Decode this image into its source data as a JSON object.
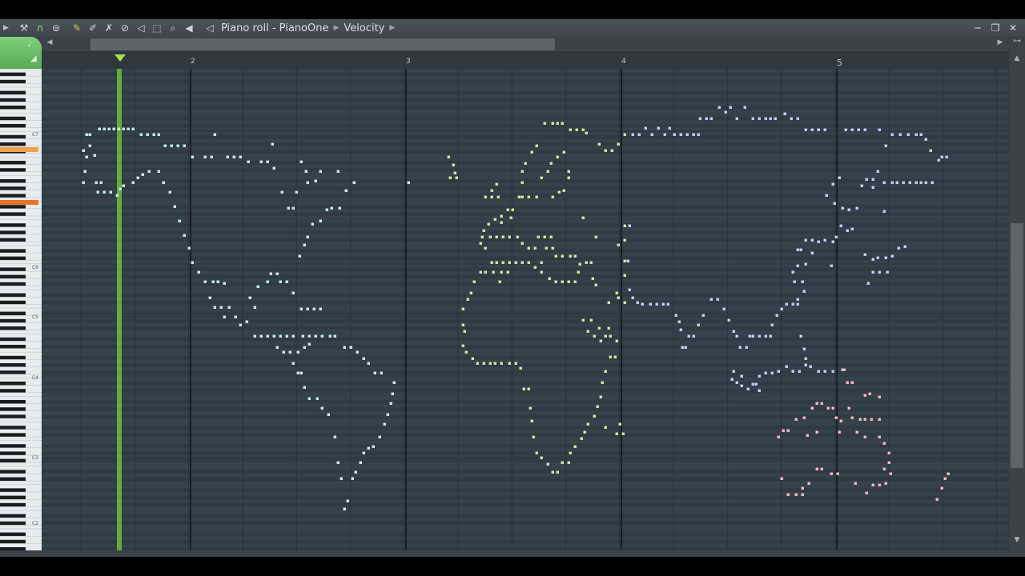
{
  "window": {
    "title": "Piano roll - PianoOne",
    "target": "Velocity",
    "controls": {
      "minimize": "─",
      "restore": "❐",
      "close": "✕"
    }
  },
  "toolbar": {
    "icons": [
      "arrow-icon",
      "wrench-icon",
      "magnet-icon",
      "menu-icon",
      "pencil-icon",
      "paint-icon",
      "delete-icon",
      "mute-icon",
      "slice-icon",
      "select-icon",
      "zoom-icon",
      "playback-icon",
      "speaker-icon"
    ]
  },
  "ruler": {
    "bars": [
      "2",
      "3",
      "4",
      "5"
    ]
  },
  "keyboard": {
    "octave_labels": [
      "C7",
      "C6",
      "C5",
      "C4",
      "C3",
      "C2"
    ]
  },
  "colors": {
    "grid_bg": "#34404a",
    "bar_line": "#1a2024",
    "playhead": "#7ccc3c",
    "note_blue": "#c7e6ea",
    "note_green": "#c8e6a0",
    "note_purple": "#c8c8f0",
    "note_pink": "#f2b6be"
  },
  "notes": [
    [
      108,
      168
    ],
    [
      112,
      168
    ],
    [
      124,
      161
    ],
    [
      130,
      161
    ],
    [
      136,
      161
    ],
    [
      142,
      161
    ],
    [
      148,
      161
    ],
    [
      154,
      161
    ],
    [
      160,
      161
    ],
    [
      166,
      161
    ],
    [
      176,
      168
    ],
    [
      184,
      168
    ],
    [
      192,
      168
    ],
    [
      198,
      168
    ],
    [
      104,
      188
    ],
    [
      108,
      196
    ],
    [
      106,
      214
    ],
    [
      112,
      182
    ],
    [
      118,
      194
    ],
    [
      206,
      182
    ],
    [
      214,
      182
    ],
    [
      222,
      182
    ],
    [
      230,
      182
    ],
    [
      240,
      196
    ],
    [
      256,
      196
    ],
    [
      264,
      196
    ],
    [
      284,
      196
    ],
    [
      292,
      196
    ],
    [
      300,
      196
    ],
    [
      310,
      202
    ],
    [
      104,
      228
    ],
    [
      120,
      228
    ],
    [
      126,
      228
    ],
    [
      122,
      240
    ],
    [
      130,
      240
    ],
    [
      138,
      240
    ],
    [
      146,
      244
    ],
    [
      150,
      236
    ],
    [
      154,
      232
    ],
    [
      166,
      228
    ],
    [
      172,
      222
    ],
    [
      178,
      218
    ],
    [
      186,
      214
    ],
    [
      198,
      214
    ],
    [
      204,
      228
    ],
    [
      212,
      240
    ],
    [
      218,
      258
    ],
    [
      224,
      276
    ],
    [
      230,
      294
    ],
    [
      236,
      310
    ],
    [
      240,
      328
    ],
    [
      248,
      340
    ],
    [
      256,
      352
    ],
    [
      266,
      352
    ],
    [
      272,
      352
    ],
    [
      280,
      354
    ],
    [
      262,
      372
    ],
    [
      268,
      384
    ],
    [
      276,
      384
    ],
    [
      280,
      396
    ],
    [
      286,
      384
    ],
    [
      294,
      396
    ],
    [
      300,
      406
    ],
    [
      308,
      402
    ],
    [
      312,
      372
    ],
    [
      318,
      384
    ],
    [
      322,
      358
    ],
    [
      334,
      352
    ],
    [
      338,
      342
    ],
    [
      346,
      342
    ],
    [
      350,
      352
    ],
    [
      358,
      352
    ],
    [
      366,
      366
    ],
    [
      376,
      386
    ],
    [
      384,
      386
    ],
    [
      392,
      386
    ],
    [
      400,
      386
    ],
    [
      326,
      202
    ],
    [
      334,
      202
    ],
    [
      340,
      180
    ],
    [
      342,
      210
    ],
    [
      352,
      240
    ],
    [
      360,
      260
    ],
    [
      366,
      260
    ],
    [
      370,
      240
    ],
    [
      376,
      202
    ],
    [
      382,
      214
    ],
    [
      384,
      228
    ],
    [
      394,
      226
    ],
    [
      400,
      214
    ],
    [
      408,
      262
    ],
    [
      414,
      260
    ],
    [
      422,
      214
    ],
    [
      424,
      260
    ],
    [
      432,
      238
    ],
    [
      442,
      228
    ],
    [
      400,
      276
    ],
    [
      390,
      280
    ],
    [
      384,
      296
    ],
    [
      380,
      306
    ],
    [
      374,
      320
    ],
    [
      268,
      168
    ],
    [
      510,
      228
    ],
    [
      318,
      420
    ],
    [
      326,
      420
    ],
    [
      334,
      420
    ],
    [
      342,
      420
    ],
    [
      350,
      420
    ],
    [
      358,
      420
    ],
    [
      366,
      420
    ],
    [
      378,
      420
    ],
    [
      386,
      420
    ],
    [
      394,
      420
    ],
    [
      402,
      420
    ],
    [
      412,
      420
    ],
    [
      418,
      420
    ],
    [
      346,
      434
    ],
    [
      354,
      440
    ],
    [
      362,
      440
    ],
    [
      372,
      440
    ],
    [
      380,
      434
    ],
    [
      386,
      430
    ],
    [
      366,
      454
    ],
    [
      372,
      466
    ],
    [
      430,
      434
    ],
    [
      438,
      434
    ],
    [
      446,
      440
    ],
    [
      454,
      448
    ],
    [
      460,
      454
    ],
    [
      468,
      466
    ],
    [
      476,
      466
    ],
    [
      492,
      478
    ],
    [
      490,
      492
    ],
    [
      488,
      504
    ],
    [
      484,
      518
    ],
    [
      480,
      530
    ],
    [
      474,
      546
    ],
    [
      466,
      558
    ],
    [
      460,
      560
    ],
    [
      454,
      566
    ],
    [
      450,
      578
    ],
    [
      444,
      590
    ],
    [
      440,
      598
    ],
    [
      434,
      626
    ],
    [
      430,
      636
    ],
    [
      426,
      598
    ],
    [
      422,
      578
    ],
    [
      418,
      546
    ],
    [
      410,
      518
    ],
    [
      402,
      510
    ],
    [
      396,
      498
    ],
    [
      386,
      498
    ],
    [
      380,
      484
    ],
    [
      376,
      466
    ],
    [
      560,
      196
    ],
    [
      566,
      206
    ],
    [
      568,
      216
    ],
    [
      562,
      222
    ],
    [
      570,
      222
    ],
    [
      680,
      154
    ],
    [
      690,
      154
    ],
    [
      696,
      154
    ],
    [
      702,
      154
    ],
    [
      712,
      162
    ],
    [
      720,
      162
    ],
    [
      728,
      162
    ],
    [
      732,
      166
    ],
    [
      670,
      182
    ],
    [
      664,
      190
    ],
    [
      656,
      204
    ],
    [
      652,
      214
    ],
    [
      652,
      228
    ],
    [
      648,
      246
    ],
    [
      634,
      262
    ],
    [
      626,
      270
    ],
    [
      618,
      274
    ],
    [
      610,
      280
    ],
    [
      604,
      288
    ],
    [
      602,
      296
    ],
    [
      612,
      296
    ],
    [
      620,
      296
    ],
    [
      628,
      296
    ],
    [
      636,
      296
    ],
    [
      646,
      296
    ],
    [
      652,
      304
    ],
    [
      660,
      310
    ],
    [
      668,
      310
    ],
    [
      672,
      296
    ],
    [
      680,
      296
    ],
    [
      688,
      296
    ],
    [
      676,
      222
    ],
    [
      684,
      214
    ],
    [
      688,
      204
    ],
    [
      696,
      196
    ],
    [
      704,
      190
    ],
    [
      710,
      214
    ],
    [
      710,
      222
    ],
    [
      704,
      238
    ],
    [
      698,
      240
    ],
    [
      690,
      246
    ],
    [
      670,
      246
    ],
    [
      660,
      246
    ],
    [
      652,
      246
    ],
    [
      620,
      230
    ],
    [
      614,
      238
    ],
    [
      606,
      246
    ],
    [
      614,
      246
    ],
    [
      622,
      246
    ],
    [
      614,
      328
    ],
    [
      620,
      328
    ],
    [
      628,
      328
    ],
    [
      636,
      328
    ],
    [
      644,
      328
    ],
    [
      652,
      328
    ],
    [
      660,
      328
    ],
    [
      668,
      334
    ],
    [
      676,
      340
    ],
    [
      686,
      348
    ],
    [
      694,
      352
    ],
    [
      702,
      352
    ],
    [
      710,
      352
    ],
    [
      718,
      352
    ],
    [
      722,
      340
    ],
    [
      724,
      330
    ],
    [
      732,
      328
    ],
    [
      738,
      328
    ],
    [
      740,
      348
    ],
    [
      744,
      356
    ],
    [
      694,
      320
    ],
    [
      702,
      320
    ],
    [
      712,
      320
    ],
    [
      718,
      320
    ],
    [
      682,
      310
    ],
    [
      690,
      310
    ],
    [
      676,
      328
    ],
    [
      624,
      352
    ],
    [
      606,
      340
    ],
    [
      600,
      340
    ],
    [
      616,
      340
    ],
    [
      638,
      272
    ],
    [
      626,
      278
    ],
    [
      640,
      262
    ],
    [
      728,
      272
    ],
    [
      744,
      296
    ],
    [
      626,
      340
    ],
    [
      634,
      340
    ],
    [
      606,
      310
    ],
    [
      600,
      304
    ],
    [
      592,
      352
    ],
    [
      588,
      366
    ],
    [
      584,
      374
    ],
    [
      578,
      386
    ],
    [
      578,
      406
    ],
    [
      580,
      414
    ],
    [
      578,
      432
    ],
    [
      582,
      440
    ],
    [
      590,
      448
    ],
    [
      596,
      454
    ],
    [
      604,
      454
    ],
    [
      612,
      454
    ],
    [
      618,
      454
    ],
    [
      626,
      454
    ],
    [
      636,
      454
    ],
    [
      644,
      454
    ],
    [
      650,
      460
    ],
    [
      654,
      486
    ],
    [
      660,
      486
    ],
    [
      662,
      510
    ],
    [
      664,
      526
    ],
    [
      666,
      546
    ],
    [
      670,
      566
    ],
    [
      676,
      572
    ],
    [
      684,
      580
    ],
    [
      690,
      590
    ],
    [
      696,
      590
    ],
    [
      702,
      578
    ],
    [
      710,
      578
    ],
    [
      712,
      566
    ],
    [
      718,
      558
    ],
    [
      726,
      548
    ],
    [
      730,
      540
    ],
    [
      734,
      530
    ],
    [
      742,
      520
    ],
    [
      746,
      508
    ],
    [
      750,
      496
    ],
    [
      752,
      478
    ],
    [
      756,
      464
    ],
    [
      762,
      446
    ],
    [
      768,
      446
    ],
    [
      770,
      426
    ],
    [
      762,
      420
    ],
    [
      756,
      420
    ],
    [
      750,
      426
    ],
    [
      742,
      420
    ],
    [
      734,
      414
    ],
    [
      728,
      400
    ],
    [
      738,
      400
    ],
    [
      748,
      410
    ],
    [
      760,
      410
    ],
    [
      770,
      542
    ],
    [
      774,
      530
    ],
    [
      778,
      542
    ],
    [
      756,
      534
    ],
    [
      748,
      180
    ],
    [
      756,
      188
    ],
    [
      764,
      188
    ],
    [
      772,
      180
    ],
    [
      780,
      168
    ],
    [
      790,
      168
    ],
    [
      798,
      168
    ],
    [
      806,
      160
    ],
    [
      814,
      168
    ],
    [
      822,
      160
    ],
    [
      830,
      168
    ],
    [
      836,
      160
    ],
    [
      842,
      168
    ],
    [
      850,
      168
    ],
    [
      858,
      168
    ],
    [
      866,
      168
    ],
    [
      872,
      168
    ],
    [
      874,
      148
    ],
    [
      882,
      148
    ],
    [
      888,
      148
    ],
    [
      898,
      134
    ],
    [
      906,
      140
    ],
    [
      912,
      134
    ],
    [
      920,
      148
    ],
    [
      930,
      134
    ],
    [
      940,
      148
    ],
    [
      948,
      148
    ],
    [
      956,
      148
    ],
    [
      962,
      148
    ],
    [
      968,
      148
    ],
    [
      980,
      142
    ],
    [
      988,
      148
    ],
    [
      996,
      148
    ],
    [
      1006,
      162
    ],
    [
      1014,
      162
    ],
    [
      1022,
      162
    ],
    [
      1030,
      162
    ],
    [
      1056,
      162
    ],
    [
      1064,
      162
    ],
    [
      1072,
      162
    ],
    [
      1080,
      162
    ],
    [
      1098,
      162
    ],
    [
      1106,
      182
    ],
    [
      1114,
      168
    ],
    [
      1124,
      168
    ],
    [
      1134,
      168
    ],
    [
      1144,
      168
    ],
    [
      1150,
      168
    ],
    [
      1156,
      174
    ],
    [
      1162,
      188
    ],
    [
      1172,
      200
    ],
    [
      1176,
      196
    ],
    [
      1182,
      196
    ],
    [
      780,
      282
    ],
    [
      786,
      282
    ],
    [
      780,
      300
    ],
    [
      772,
      306
    ],
    [
      784,
      326
    ],
    [
      780,
      344
    ],
    [
      786,
      362
    ],
    [
      772,
      372
    ],
    [
      760,
      378
    ],
    [
      770,
      366
    ],
    [
      780,
      378
    ],
    [
      790,
      372
    ],
    [
      796,
      378
    ],
    [
      802,
      380
    ],
    [
      812,
      380
    ],
    [
      820,
      380
    ],
    [
      828,
      380
    ],
    [
      834,
      380
    ],
    [
      844,
      394
    ],
    [
      848,
      402
    ],
    [
      850,
      412
    ],
    [
      852,
      434
    ],
    [
      856,
      434
    ],
    [
      860,
      420
    ],
    [
      866,
      420
    ],
    [
      872,
      406
    ],
    [
      878,
      394
    ],
    [
      888,
      374
    ],
    [
      896,
      374
    ],
    [
      904,
      386
    ],
    [
      910,
      400
    ],
    [
      916,
      414
    ],
    [
      920,
      420
    ],
    [
      924,
      434
    ],
    [
      932,
      434
    ],
    [
      936,
      420
    ],
    [
      940,
      420
    ],
    [
      948,
      420
    ],
    [
      956,
      420
    ],
    [
      962,
      420
    ],
    [
      964,
      406
    ],
    [
      970,
      394
    ],
    [
      976,
      386
    ],
    [
      982,
      380
    ],
    [
      990,
      380
    ],
    [
      996,
      374
    ],
    [
      1004,
      364
    ],
    [
      1002,
      352
    ],
    [
      992,
      352
    ],
    [
      990,
      340
    ],
    [
      996,
      332
    ],
    [
      1006,
      330
    ],
    [
      1014,
      316
    ],
    [
      1022,
      302
    ],
    [
      1030,
      300
    ],
    [
      1040,
      302
    ],
    [
      1044,
      296
    ],
    [
      1050,
      282
    ],
    [
      1058,
      288
    ],
    [
      1064,
      286
    ],
    [
      1038,
      332
    ],
    [
      1032,
      244
    ],
    [
      1040,
      230
    ],
    [
      1048,
      222
    ],
    [
      1042,
      254
    ],
    [
      1052,
      260
    ],
    [
      1060,
      262
    ],
    [
      1070,
      260
    ],
    [
      1076,
      232
    ],
    [
      1082,
      224
    ],
    [
      1090,
      224
    ],
    [
      1096,
      214
    ],
    [
      1104,
      228
    ],
    [
      1114,
      228
    ],
    [
      1120,
      228
    ],
    [
      1128,
      228
    ],
    [
      1136,
      228
    ],
    [
      1144,
      228
    ],
    [
      1150,
      228
    ],
    [
      1156,
      228
    ],
    [
      1164,
      228
    ],
    [
      1104,
      264
    ],
    [
      1090,
      234
    ],
    [
      1080,
      318
    ],
    [
      1090,
      324
    ],
    [
      1096,
      322
    ],
    [
      1106,
      322
    ],
    [
      1114,
      320
    ],
    [
      1122,
      310
    ],
    [
      1130,
      308
    ],
    [
      1090,
      340
    ],
    [
      1098,
      340
    ],
    [
      1108,
      340
    ],
    [
      1084,
      354
    ],
    [
      996,
      312
    ],
    [
      1000,
      312
    ],
    [
      1006,
      300
    ],
    [
      1014,
      300
    ],
    [
      1000,
      420
    ],
    [
      1004,
      436
    ],
    [
      1006,
      448
    ],
    [
      1006,
      456
    ],
    [
      998,
      464
    ],
    [
      990,
      464
    ],
    [
      982,
      458
    ],
    [
      972,
      464
    ],
    [
      964,
      466
    ],
    [
      956,
      466
    ],
    [
      948,
      470
    ],
    [
      940,
      480
    ],
    [
      934,
      486
    ],
    [
      926,
      482
    ],
    [
      920,
      478
    ],
    [
      916,
      464
    ],
    [
      914,
      474
    ],
    [
      926,
      470
    ],
    [
      944,
      480
    ],
    [
      948,
      488
    ],
    [
      996,
      380
    ],
    [
      1012,
      458
    ],
    [
      1022,
      464
    ],
    [
      1030,
      464
    ],
    [
      1040,
      464
    ],
    [
      1052,
      462
    ],
    [
      780,
      326
    ],
    [
      780,
      344
    ]
  ],
  "notes_pink": [
    [
      1054,
      462
    ],
    [
      1058,
      478
    ],
    [
      1064,
      478
    ],
    [
      1080,
      494
    ],
    [
      1086,
      492
    ],
    [
      1098,
      496
    ],
    [
      1060,
      510
    ],
    [
      1064,
      522
    ],
    [
      1074,
      524
    ],
    [
      1080,
      524
    ],
    [
      1088,
      524
    ],
    [
      1098,
      524
    ],
    [
      1050,
      526
    ],
    [
      1044,
      522
    ],
    [
      1040,
      510
    ],
    [
      1034,
      510
    ],
    [
      1026,
      504
    ],
    [
      1020,
      504
    ],
    [
      1014,
      510
    ],
    [
      1004,
      522
    ],
    [
      994,
      524
    ],
    [
      984,
      538
    ],
    [
      978,
      538
    ],
    [
      972,
      546
    ],
    [
      1008,
      544
    ],
    [
      1020,
      540
    ],
    [
      1048,
      540
    ],
    [
      1070,
      540
    ],
    [
      1080,
      546
    ],
    [
      1098,
      546
    ],
    [
      1104,
      554
    ],
    [
      1110,
      566
    ],
    [
      1110,
      578
    ],
    [
      1104,
      586
    ],
    [
      1112,
      592
    ],
    [
      1106,
      604
    ],
    [
      1098,
      606
    ],
    [
      1090,
      606
    ],
    [
      1082,
      616
    ],
    [
      1068,
      604
    ],
    [
      1046,
      592
    ],
    [
      1038,
      592
    ],
    [
      1026,
      586
    ],
    [
      1020,
      586
    ],
    [
      1010,
      604
    ],
    [
      1002,
      610
    ],
    [
      994,
      618
    ],
    [
      984,
      618
    ],
    [
      976,
      598
    ],
    [
      1002,
      618
    ],
    [
      1184,
      592
    ],
    [
      1180,
      598
    ],
    [
      1176,
      610
    ],
    [
      1170,
      624
    ]
  ]
}
